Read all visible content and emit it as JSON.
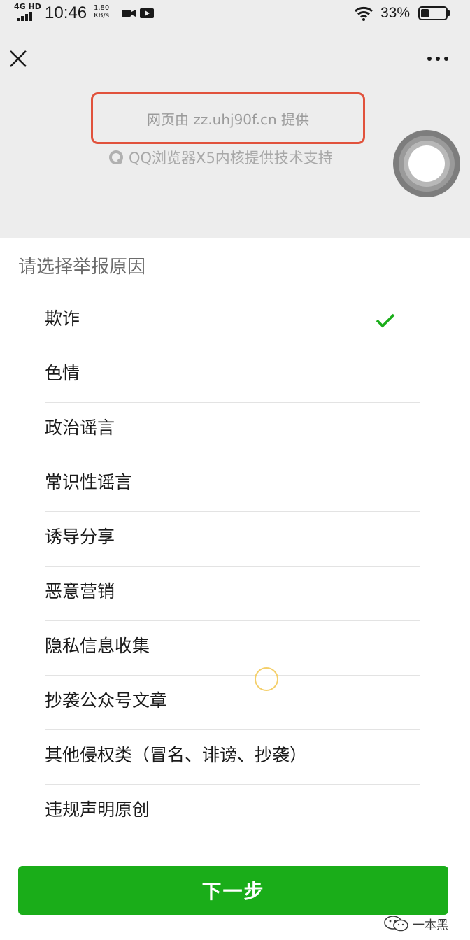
{
  "status_bar": {
    "network": "4G HD",
    "time": "10:46",
    "speed_value": "1.80",
    "speed_unit": "KB/s",
    "battery": "33%",
    "battery_level": 0.33
  },
  "nav": {
    "close_icon": "close-icon",
    "more_icon": "more-icon"
  },
  "web_info": {
    "provider": "网页由 zz.uhj90f.cn 提供",
    "browser_support": "QQ浏览器X5内核提供技术支持"
  },
  "report": {
    "title": "请选择举报原因",
    "reasons": [
      {
        "label": "欺诈",
        "selected": true
      },
      {
        "label": "色情",
        "selected": false
      },
      {
        "label": "政治谣言",
        "selected": false
      },
      {
        "label": "常识性谣言",
        "selected": false
      },
      {
        "label": "诱导分享",
        "selected": false
      },
      {
        "label": "恶意营销",
        "selected": false
      },
      {
        "label": "隐私信息收集",
        "selected": false
      },
      {
        "label": "抄袭公众号文章",
        "selected": false
      },
      {
        "label": "其他侵权类（冒名、诽谤、抄袭）",
        "selected": false
      },
      {
        "label": "违规声明原创",
        "selected": false
      }
    ],
    "next_button": "下一步"
  },
  "watermark": "一本黑",
  "colors": {
    "accent_green": "#1aad19",
    "highlight_red": "#e1523c",
    "background_grey": "#ededed"
  }
}
